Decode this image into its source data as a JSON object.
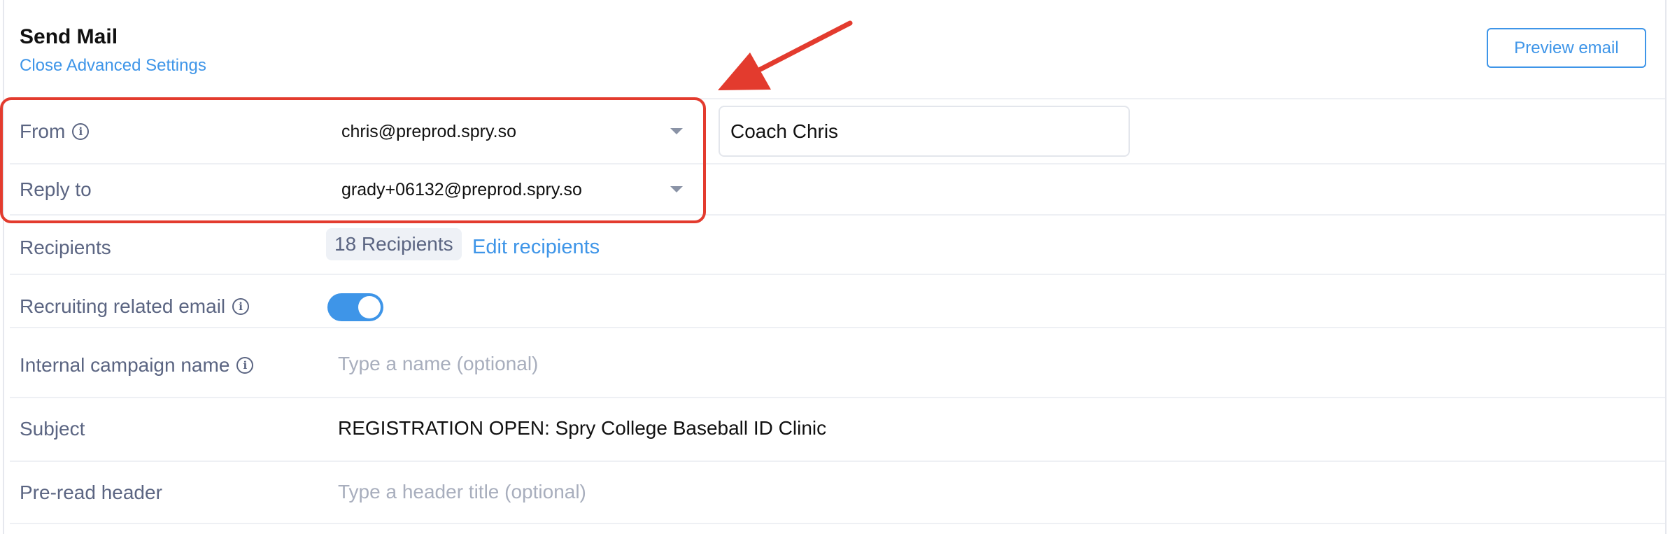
{
  "header": {
    "title": "Send Mail",
    "advanced_link": "Close Advanced Settings",
    "preview_button": "Preview email"
  },
  "from": {
    "label": "From",
    "value": "chris@preprod.spry.so",
    "display_name": "Coach Chris"
  },
  "reply_to": {
    "label": "Reply to",
    "value": "grady+06132@preprod.spry.so"
  },
  "recipients": {
    "label": "Recipients",
    "count_badge": "18 Recipients",
    "edit_link": "Edit recipients"
  },
  "recruiting": {
    "label": "Recruiting related email",
    "enabled": true
  },
  "campaign": {
    "label": "Internal campaign name",
    "placeholder": "Type a name (optional)"
  },
  "subject": {
    "label": "Subject",
    "value": "REGISTRATION OPEN: Spry College Baseball ID Clinic"
  },
  "preread": {
    "label": "Pre-read header",
    "placeholder": "Type a header title (optional)"
  },
  "colors": {
    "accent": "#3e95e8",
    "annotation": "#e33b2e",
    "label": "#5b6582"
  },
  "icons": {
    "info": "info-circle-icon",
    "dropdown": "chevron-down-icon",
    "annotation": "red-arrow"
  }
}
